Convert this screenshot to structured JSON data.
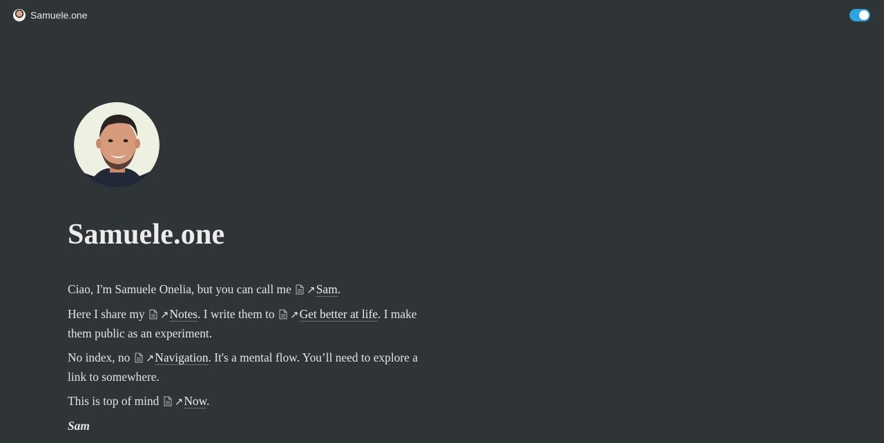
{
  "topbar": {
    "site_name": "Samuele.one",
    "theme_toggle": "on"
  },
  "page": {
    "title": "Samuele.one"
  },
  "intro": {
    "p1_before": "Ciao, I'm  Samuele Onelia, but you can call me",
    "p1_link": "Sam",
    "p1_after": ".",
    "p2_before": "Here I share my",
    "p2_link1": "Notes",
    "p2_mid": ". I write them to",
    "p2_link2": "Get better at life",
    "p2_after": ". I make them public as an experiment.",
    "p3_before": "No index, no",
    "p3_link": "Navigation",
    "p3_after": ". It's a mental flow. You’ll need to explore a link to somewhere.",
    "p4_before": "This is top of mind",
    "p4_link": "Now",
    "p4_after": ".",
    "signature": "Sam"
  },
  "icons": {
    "page": "doc-icon",
    "link": "arrow-up-right-icon",
    "toggle": "theme-toggle"
  },
  "colors": {
    "background": "#2f3437",
    "accent": "#2ea4e0",
    "text": "#e6e6e6"
  }
}
